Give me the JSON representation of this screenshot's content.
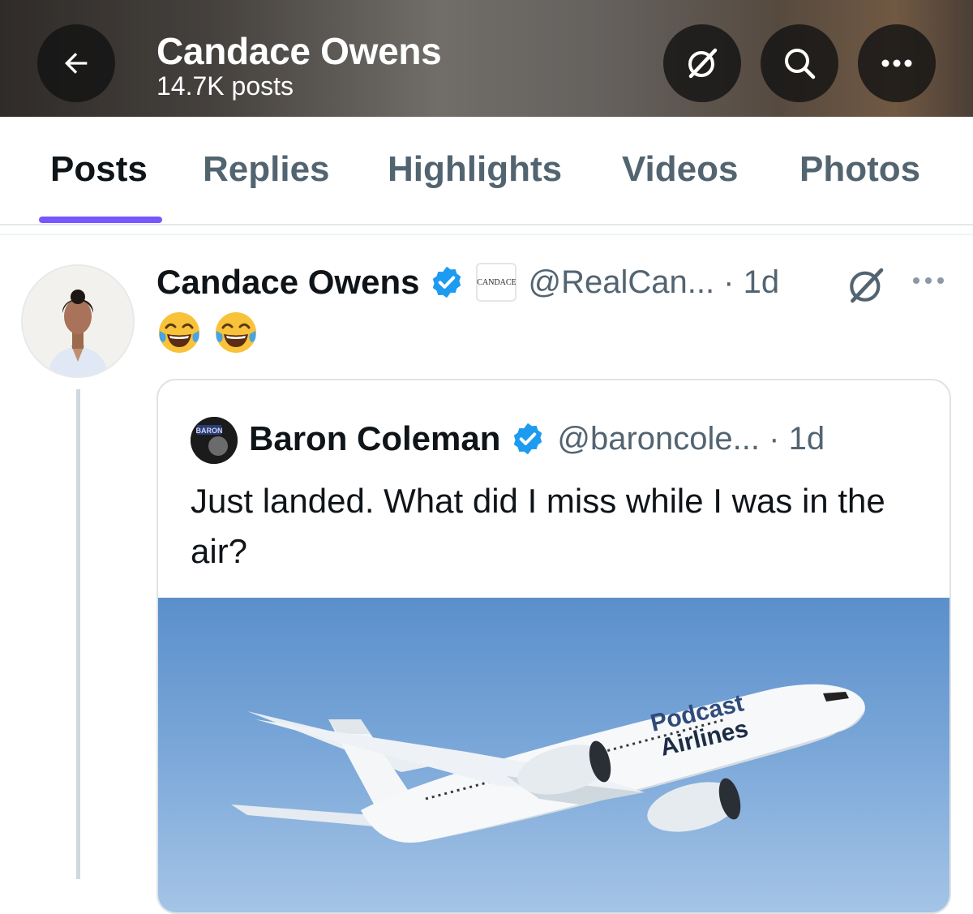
{
  "header": {
    "title": "Candace Owens",
    "subtitle": "14.7K posts",
    "icons": [
      "back-arrow-icon",
      "grok-icon",
      "search-icon",
      "more-icon"
    ]
  },
  "tabs": [
    {
      "label": "Posts",
      "active": true
    },
    {
      "label": "Replies",
      "active": false
    },
    {
      "label": "Highlights",
      "active": false
    },
    {
      "label": "Videos",
      "active": false
    },
    {
      "label": "Photos",
      "active": false
    }
  ],
  "post": {
    "author": "Candace Owens",
    "affiliate_badge": "CANDACE",
    "meta": "@RealCan... · 1d",
    "text": "😂😂"
  },
  "quote": {
    "author": "Baron Coleman",
    "meta": "@baroncole... · 1d",
    "text": "Just landed.  What did I miss while I was in the air?",
    "avatar_text": "BARON",
    "image": {
      "livery_line1": "Podcast",
      "livery_line2": "Airlines"
    }
  },
  "colors": {
    "accent": "#7856ff",
    "verified": "#1d9bf0",
    "text_primary": "#0f1419",
    "text_secondary": "#536471"
  }
}
